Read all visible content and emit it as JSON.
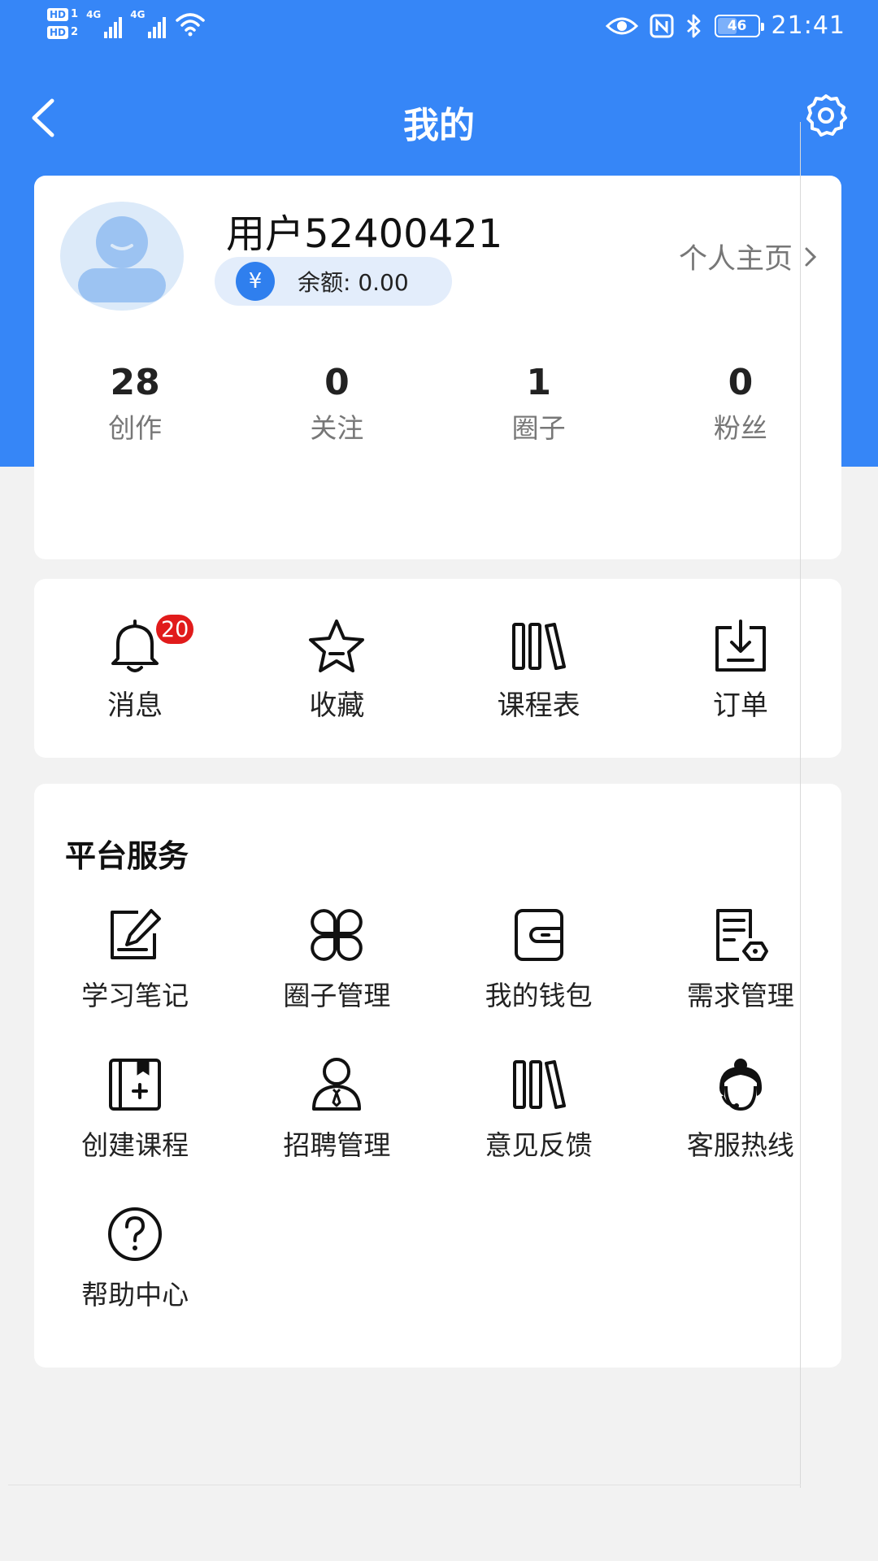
{
  "status_bar": {
    "hd1": "HD",
    "hd1_num": "1",
    "hd2": "HD",
    "hd2_num": "2",
    "net1": "4G",
    "net2": "4G",
    "battery": "46",
    "battery_fraction": 0.46,
    "time": "21:41"
  },
  "header": {
    "title": "我的"
  },
  "profile": {
    "name": "用户52400421",
    "balance": "余额: 0.00",
    "currency_symbol": "¥",
    "homepage_link": "个人主页"
  },
  "stats": [
    {
      "value": "28",
      "label": "创作"
    },
    {
      "value": "0",
      "label": "关注"
    },
    {
      "value": "1",
      "label": "圈子"
    },
    {
      "value": "0",
      "label": "粉丝"
    }
  ],
  "quick_actions": [
    {
      "label": "消息",
      "icon": "bell-icon",
      "badge": "20"
    },
    {
      "label": "收藏",
      "icon": "star-icon"
    },
    {
      "label": "课程表",
      "icon": "books-icon"
    },
    {
      "label": "订单",
      "icon": "download-box-icon"
    }
  ],
  "services": {
    "title": "平台服务",
    "items": [
      {
        "label": "学习笔记",
        "icon": "note-edit-icon"
      },
      {
        "label": "圈子管理",
        "icon": "four-petal-icon"
      },
      {
        "label": "我的钱包",
        "icon": "wallet-icon"
      },
      {
        "label": "需求管理",
        "icon": "document-tag-icon"
      },
      {
        "label": "创建课程",
        "icon": "book-add-icon"
      },
      {
        "label": "招聘管理",
        "icon": "person-tie-icon"
      },
      {
        "label": "意见反馈",
        "icon": "books-icon"
      },
      {
        "label": "客服热线",
        "icon": "headset-agent-icon"
      },
      {
        "label": "帮助中心",
        "icon": "help-circle-icon"
      }
    ]
  },
  "colors": {
    "primary": "#3686f7",
    "badge": "#e11b1b",
    "page_bg": "#f2f2f2"
  }
}
